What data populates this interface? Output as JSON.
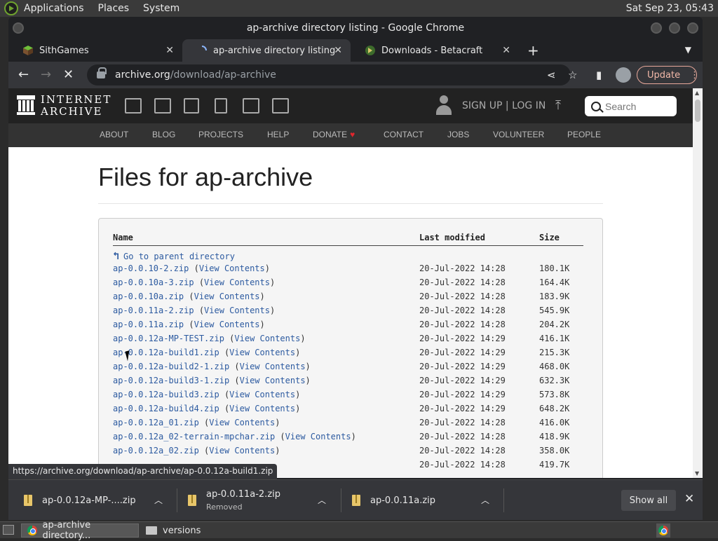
{
  "system": {
    "menus": [
      "Applications",
      "Places",
      "System"
    ],
    "clock": "Sat Sep 23, 05:43"
  },
  "window": {
    "title": "ap-archive directory listing - Google Chrome"
  },
  "tabs": [
    {
      "label": "SithGames",
      "icon": "minecraft-block-icon"
    },
    {
      "label": "ap-archive directory listing",
      "icon": "loading-spinner-icon"
    },
    {
      "label": "Downloads - Betacraft",
      "icon": "betacraft-icon"
    }
  ],
  "omnibox": {
    "host": "archive.org",
    "path": "/download/ap-archive"
  },
  "toolbar": {
    "update_label": "Update"
  },
  "ia": {
    "wordmark_line1": "INTERNET",
    "wordmark_line2": "ARCHIVE",
    "signup": "SIGN UP | LOG IN",
    "search_placeholder": "Search",
    "nav": [
      "ABOUT",
      "BLOG",
      "PROJECTS",
      "HELP",
      "DONATE",
      "CONTACT",
      "JOBS",
      "VOLUNTEER",
      "PEOPLE"
    ]
  },
  "page": {
    "title": "Files for ap-archive",
    "headers": {
      "name": "Name",
      "modified": "Last modified",
      "size": "Size"
    },
    "parent_link": "Go to parent directory",
    "view_contents": "View Contents",
    "files": [
      {
        "name": "ap-0.0.10-2.zip",
        "date": "20-Jul-2022 14:28",
        "size": "180.1K"
      },
      {
        "name": "ap-0.0.10a-3.zip",
        "date": "20-Jul-2022 14:28",
        "size": "164.4K"
      },
      {
        "name": "ap-0.0.10a.zip",
        "date": "20-Jul-2022 14:28",
        "size": "183.9K"
      },
      {
        "name": "ap-0.0.11a-2.zip",
        "date": "20-Jul-2022 14:28",
        "size": "545.9K"
      },
      {
        "name": "ap-0.0.11a.zip",
        "date": "20-Jul-2022 14:28",
        "size": "204.2K"
      },
      {
        "name": "ap-0.0.12a-MP-TEST.zip",
        "date": "20-Jul-2022 14:29",
        "size": "416.1K"
      },
      {
        "name": "ap-0.0.12a-build1.zip",
        "date": "20-Jul-2022 14:29",
        "size": "215.3K"
      },
      {
        "name": "ap-0.0.12a-build2-1.zip",
        "date": "20-Jul-2022 14:29",
        "size": "468.0K"
      },
      {
        "name": "ap-0.0.12a-build3-1.zip",
        "date": "20-Jul-2022 14:29",
        "size": "632.3K"
      },
      {
        "name": "ap-0.0.12a-build3.zip",
        "date": "20-Jul-2022 14:29",
        "size": "573.8K"
      },
      {
        "name": "ap-0.0.12a-build4.zip",
        "date": "20-Jul-2022 14:29",
        "size": "648.2K"
      },
      {
        "name": "ap-0.0.12a_01.zip",
        "date": "20-Jul-2022 14:28",
        "size": "416.0K"
      },
      {
        "name": "ap-0.0.12a_02-terrain-mpchar.zip",
        "date": "20-Jul-2022 14:28",
        "size": "418.9K"
      },
      {
        "name": "ap-0.0.12a_02.zip",
        "date": "20-Jul-2022 14:28",
        "size": "358.0K"
      },
      {
        "name": "",
        "date": "20-Jul-2022 14:28",
        "size": "419.7K"
      }
    ]
  },
  "status_url": "https://archive.org/download/ap-archive/ap-0.0.12a-build1.zip",
  "downloads": {
    "items": [
      {
        "name": "ap-0.0.12a-MP-....zip",
        "sub": ""
      },
      {
        "name": "ap-0.0.11a-2.zip",
        "sub": "Removed"
      },
      {
        "name": "ap-0.0.11a.zip",
        "sub": ""
      }
    ],
    "show_all": "Show all"
  },
  "taskbar": {
    "items": [
      {
        "label": "ap-archive directory..."
      },
      {
        "label": "versions"
      }
    ]
  }
}
